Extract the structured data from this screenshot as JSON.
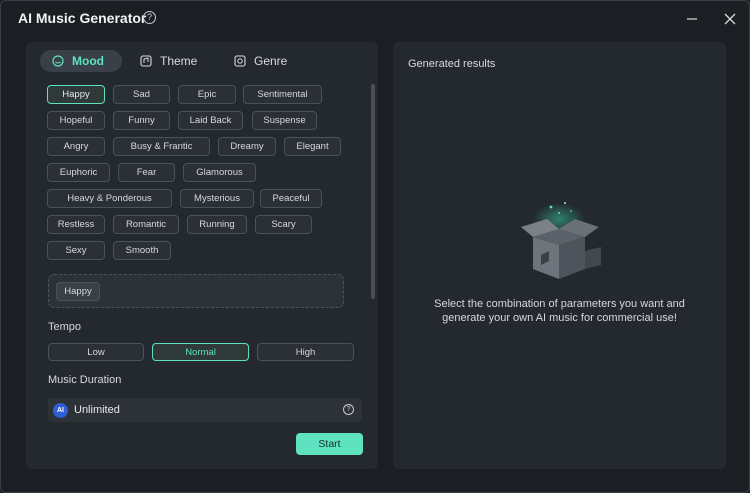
{
  "window": {
    "title": "AI Music Generator",
    "help_glyph": "?"
  },
  "tabs": [
    {
      "label": "Mood",
      "icon": "mood-icon",
      "active": true
    },
    {
      "label": "Theme",
      "icon": "theme-icon",
      "active": false
    },
    {
      "label": "Genre",
      "icon": "genre-icon",
      "active": false
    }
  ],
  "moods": [
    "Happy",
    "Sad",
    "Epic",
    "Sentimental",
    "Hopeful",
    "Funny",
    "Laid Back",
    "Suspense",
    "Angry",
    "Busy & Frantic",
    "Dreamy",
    "Elegant",
    "Euphoric",
    "Fear",
    "Glamorous",
    "Heavy & Ponderous",
    "Mysterious",
    "Peaceful",
    "Restless",
    "Romantic",
    "Running",
    "Scary",
    "Sexy",
    "Smooth"
  ],
  "selected_mood": "Happy",
  "tempo": {
    "label": "Tempo",
    "options": [
      "Low",
      "Normal",
      "High"
    ],
    "selected": "Normal"
  },
  "duration": {
    "label": "Music Duration",
    "badge": "AI",
    "value": "Unlimited",
    "help_glyph": "?"
  },
  "start_label": "Start",
  "results": {
    "title": "Generated results",
    "empty_message": "Select the combination of parameters you want and generate your own AI music for commercial use!"
  },
  "colors": {
    "accent": "#5ee2bf",
    "panel": "#24292f",
    "background": "#1b1e23"
  }
}
